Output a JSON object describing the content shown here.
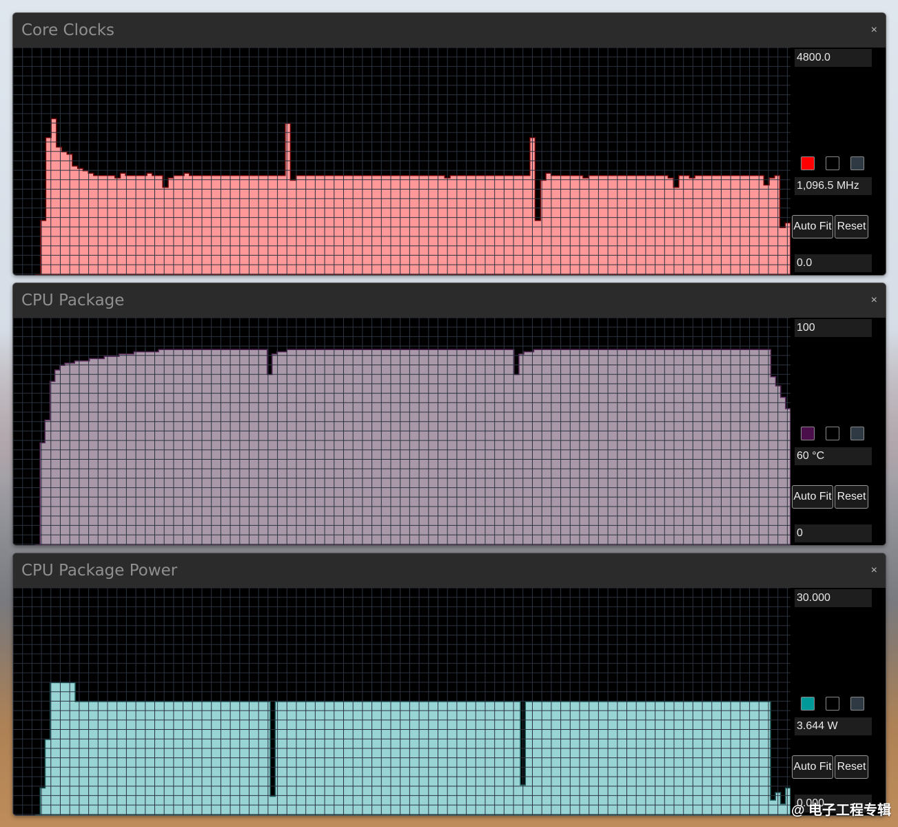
{
  "watermark": "@ 电子工程专辑",
  "panels": [
    {
      "title": "Core Clocks",
      "close": "×",
      "axis_max": "4800.0",
      "axis_min": "0.0",
      "current": "1,096.5 MHz",
      "autofit": "Auto Fit",
      "reset": "Reset",
      "color": "#ff0000",
      "fill": "#ff9898",
      "stroke": "#6a0000",
      "swatches": [
        "#ff0000",
        "#000000",
        "#2f3943"
      ]
    },
    {
      "title": "CPU Package",
      "close": "×",
      "axis_max": "100",
      "axis_min": "0",
      "current": "60 °C",
      "autofit": "Auto Fit",
      "reset": "Reset",
      "color": "#4a0f4a",
      "fill": "#a898a8",
      "stroke": "#5a2b5a",
      "swatches": [
        "#4a0f4a",
        "#000000",
        "#2f3943"
      ]
    },
    {
      "title": "CPU Package Power",
      "close": "×",
      "axis_max": "30.000",
      "axis_min": "0.000",
      "current": "3.644 W",
      "autofit": "Auto Fit",
      "reset": "Reset",
      "color": "#009999",
      "fill": "#98d4d4",
      "stroke": "#1a5a5a",
      "swatches": [
        "#009999",
        "#000000",
        "#2f3943"
      ]
    }
  ],
  "chart_data": [
    {
      "type": "area",
      "title": "Core Clocks",
      "unit": "MHz",
      "ylim": [
        0,
        4800
      ],
      "grid": true,
      "values": [
        0,
        1150,
        2900,
        3300,
        2700,
        2600,
        2550,
        2300,
        2250,
        2200,
        2150,
        2100,
        2100,
        2100,
        2100,
        2050,
        2150,
        2100,
        2100,
        2100,
        2100,
        2150,
        2100,
        2100,
        1850,
        2050,
        2100,
        2100,
        2150,
        2100,
        2100,
        2100,
        2100,
        2100,
        2100,
        2100,
        2100,
        2100,
        2100,
        2100,
        2100,
        2100,
        2100,
        2100,
        2100,
        2100,
        2100,
        3200,
        2000,
        2100,
        2100,
        2100,
        2100,
        2100,
        2100,
        2100,
        2100,
        2100,
        2100,
        2100,
        2100,
        2100,
        2100,
        2100,
        2100,
        2100,
        2100,
        2100,
        2100,
        2100,
        2100,
        2100,
        2100,
        2100,
        2100,
        2100,
        2100,
        2050,
        2100,
        2100,
        2100,
        2100,
        2100,
        2100,
        2100,
        2100,
        2100,
        2100,
        2100,
        2100,
        2100,
        2100,
        2100,
        2900,
        1150,
        2000,
        2150,
        2100,
        2100,
        2100,
        2100,
        2100,
        2100,
        2050,
        2100,
        2100,
        2100,
        2100,
        2100,
        2100,
        2100,
        2100,
        2100,
        2100,
        2100,
        2100,
        2100,
        2100,
        2100,
        2050,
        1850,
        2100,
        2100,
        2050,
        2100,
        2100,
        2100,
        2100,
        2100,
        2100,
        2100,
        2100,
        2100,
        2100,
        2100,
        2100,
        2100,
        1900,
        2050,
        2100,
        1000,
        1100
      ]
    },
    {
      "type": "area",
      "title": "CPU Package",
      "unit": "°C",
      "ylim": [
        0,
        100
      ],
      "grid": true,
      "values": [
        0,
        45,
        55,
        72,
        77,
        79,
        80,
        80,
        81,
        81,
        81,
        82,
        82,
        82,
        83,
        83,
        83,
        84,
        84,
        84,
        85,
        85,
        85,
        85,
        85,
        86,
        86,
        86,
        86,
        86,
        86,
        86,
        86,
        86,
        86,
        86,
        86,
        86,
        86,
        86,
        86,
        86,
        86,
        86,
        86,
        86,
        86,
        75,
        84,
        85,
        85,
        86,
        86,
        86,
        86,
        86,
        86,
        86,
        86,
        86,
        86,
        86,
        86,
        86,
        86,
        86,
        86,
        86,
        86,
        86,
        86,
        86,
        86,
        86,
        86,
        86,
        86,
        86,
        86,
        86,
        86,
        86,
        86,
        86,
        86,
        86,
        86,
        86,
        86,
        86,
        86,
        86,
        86,
        86,
        86,
        86,
        86,
        75,
        84,
        85,
        85,
        86,
        86,
        86,
        86,
        86,
        86,
        86,
        86,
        86,
        86,
        86,
        86,
        86,
        86,
        86,
        86,
        86,
        86,
        86,
        86,
        86,
        86,
        86,
        86,
        86,
        86,
        86,
        86,
        86,
        86,
        86,
        86,
        86,
        86,
        86,
        86,
        86,
        86,
        86,
        86,
        86,
        86,
        86,
        86,
        86,
        86,
        86,
        86,
        74,
        70,
        65,
        60
      ]
    },
    {
      "type": "area",
      "title": "CPU Package Power",
      "unit": "W",
      "ylim": [
        0,
        30
      ],
      "grid": true,
      "values": [
        0,
        3.6,
        10,
        17.5,
        17.5,
        17.5,
        17.5,
        17.5,
        15,
        15,
        15,
        15,
        15,
        15,
        15,
        15,
        15,
        15,
        15,
        15,
        15,
        15,
        15,
        15,
        15,
        15,
        15,
        15,
        15,
        15,
        15,
        15,
        15,
        15,
        15,
        15,
        15,
        15,
        15,
        15,
        15,
        15,
        15,
        15,
        15,
        15,
        15,
        2.5,
        15,
        15,
        15,
        15,
        15,
        15,
        15,
        15,
        15,
        15,
        15,
        15,
        15,
        15,
        15,
        15,
        15,
        15,
        15,
        15,
        15,
        15,
        15,
        15,
        15,
        15,
        15,
        15,
        15,
        15,
        15,
        15,
        15,
        15,
        15,
        15,
        15,
        15,
        15,
        15,
        15,
        15,
        15,
        15,
        15,
        15,
        15,
        15,
        15,
        4,
        15,
        15,
        15,
        15,
        15,
        15,
        15,
        15,
        15,
        15,
        15,
        15,
        15,
        15,
        15,
        15,
        15,
        15,
        15,
        15,
        15,
        15,
        15,
        15,
        15,
        15,
        15,
        15,
        15,
        15,
        15,
        15,
        15,
        15,
        15,
        15,
        15,
        15,
        15,
        15,
        15,
        15,
        15,
        15,
        15,
        15,
        15,
        15,
        15,
        2,
        3,
        1.5,
        3.6
      ]
    }
  ]
}
